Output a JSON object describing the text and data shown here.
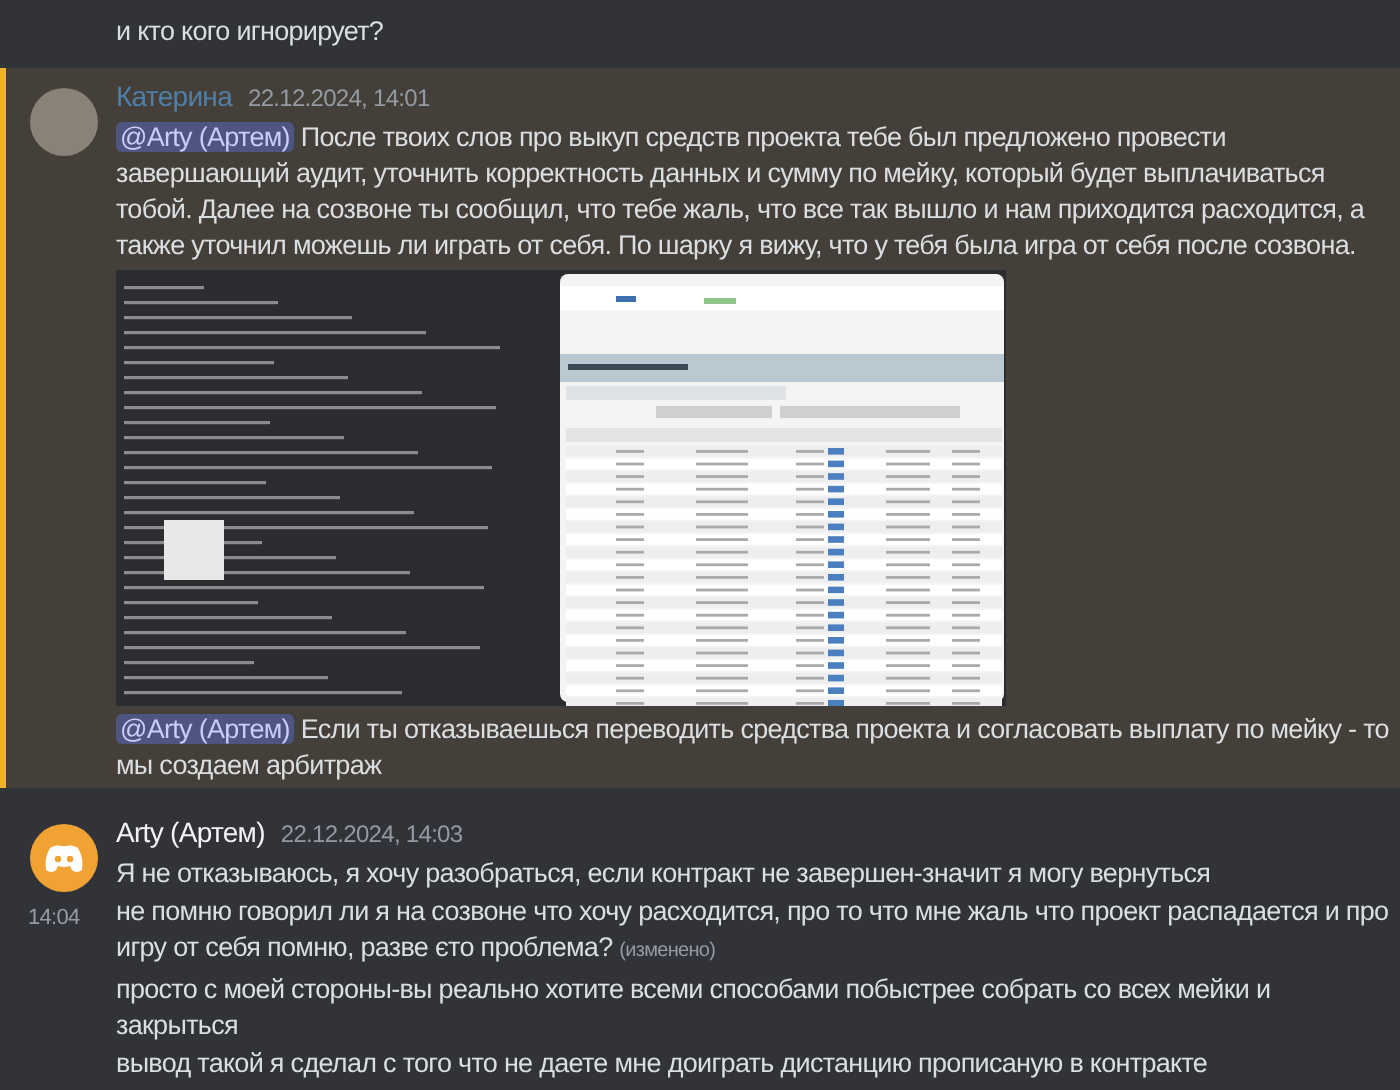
{
  "top_message": {
    "text": "и кто кого игнорирует?"
  },
  "messages": [
    {
      "author": "Катерина",
      "color": "#4f7fa8",
      "timestamp": "22.12.2024, 14:01",
      "highlighted": true,
      "avatar": {
        "kind": "photo"
      },
      "parts": [
        {
          "kind": "text",
          "mention": "@Arty (Артем)",
          "text": "После твоих слов про выкуп средств проекта тебе был предложено провести завершающий аудит, уточнить корректность данных и сумму по мейку, который будет выплачиваться тобой. Далее на созвоне  ты сообщил, что тебе жаль, что все так вышло и нам приходится расходится, а также уточнил можешь ли играть от себя. По шарку я вижу, что у тебя была игра от себя после созвона."
        },
        {
          "kind": "image"
        },
        {
          "kind": "text",
          "mention": "@Arty (Артем)",
          "text": "Если ты отказываешься переводить средства проекта и согласовать выплату по мейку - то мы создаем арбитраж"
        }
      ]
    },
    {
      "author": "Arty (Артем)",
      "color": "#f2f3f5",
      "timestamp": "22.12.2024, 14:03",
      "highlighted": false,
      "avatar": {
        "kind": "discord"
      },
      "parts": [
        {
          "kind": "text",
          "text": "Я не отказываюсь, я хочу разобраться, если контракт не завершен-значит я могу вернуться"
        },
        {
          "kind": "text",
          "hover_time": "14:04",
          "text": "не помню говорил ли я на созвоне что хочу расходится, про то что мне жаль что проект распадается и про игру от себя помню, разве єто проблема?",
          "edited": "(изменено)"
        },
        {
          "kind": "text",
          "text": "просто с моей стороны-вы реально хотите всеми способами побыстрее собрать со всех мейки и закрыться"
        },
        {
          "kind": "text",
          "text": "вывод такой я сделал с того что не даете мне доиграть дистанцию прописаную в контракте"
        }
      ]
    }
  ]
}
